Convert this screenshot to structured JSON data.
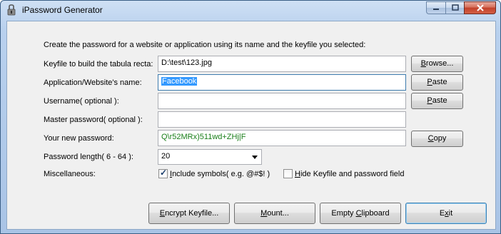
{
  "window": {
    "title": "iPassword Generator",
    "controls": {
      "minimize": "–",
      "maximize": "□",
      "close": "✕"
    }
  },
  "intro": "Create the password for a website or application using its name and the keyfile you selected:",
  "rows": {
    "keyfile": {
      "label": "Keyfile to build the tabula recta:",
      "value": "D:\\test\\123.jpg",
      "button_pre": "",
      "button_u": "B",
      "button_post": "rowse..."
    },
    "appname": {
      "label": "Application/Website's name:",
      "value": "Facebook",
      "button_pre": "",
      "button_u": "P",
      "button_post": "aste"
    },
    "username": {
      "label": "Username( optional ):",
      "value": "",
      "button_pre": "",
      "button_u": "P",
      "button_post": "aste"
    },
    "master": {
      "label": "Master password( optional ):",
      "value": ""
    },
    "newpass": {
      "label": "Your new password:",
      "value": "Q\\r52MRx)511wd+ZHj|F",
      "button_pre": "",
      "button_u": "C",
      "button_post": "opy"
    },
    "length": {
      "label": "Password length( 6 - 64 ):",
      "value": "20"
    },
    "misc": {
      "label": "Miscellaneous:",
      "symbols": {
        "checked": true,
        "u": "I",
        "rest": "nclude symbols( e.g. @#$! )"
      },
      "hide": {
        "checked": false,
        "u": "H",
        "rest": "ide Keyfile and password field"
      }
    }
  },
  "bottom_buttons": {
    "encrypt": {
      "u": "E",
      "rest": "ncrypt Keyfile..."
    },
    "mount": {
      "u": "M",
      "rest": "ount..."
    },
    "clipboard": {
      "pre": "Empty ",
      "u": "C",
      "rest": "lipboard"
    },
    "exit": {
      "pre": "E",
      "u": "x",
      "rest": "it"
    }
  }
}
